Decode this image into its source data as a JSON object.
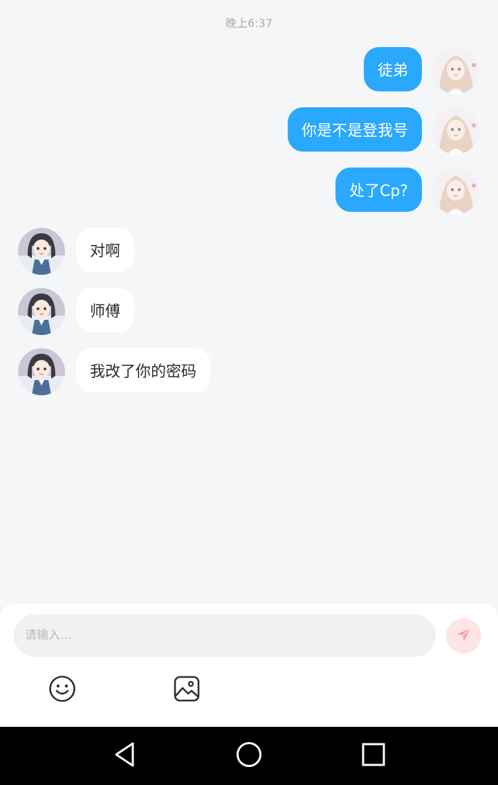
{
  "timestamp": "晚上6:37",
  "messages": [
    {
      "side": "right",
      "text": "徒弟"
    },
    {
      "side": "right",
      "text": "你是不是登我号"
    },
    {
      "side": "right",
      "text": "处了Cp?"
    },
    {
      "side": "left",
      "text": "对啊"
    },
    {
      "side": "left",
      "text": "师傅"
    },
    {
      "side": "left",
      "text": "我改了你的密码"
    }
  ],
  "composer": {
    "placeholder": "请输入...",
    "send_icon": "paper-plane-icon",
    "tools": [
      "emoji-icon",
      "image-icon"
    ]
  },
  "navbar": {
    "icons": [
      "back-triangle-icon",
      "home-circle-icon",
      "recents-square-icon"
    ]
  },
  "colors": {
    "background": "#f5f6f8",
    "bubble_sent": "#2aa8fb",
    "bubble_received": "#ffffff",
    "send_button": "#fde5e6",
    "send_icon": "#f6a0a6"
  }
}
